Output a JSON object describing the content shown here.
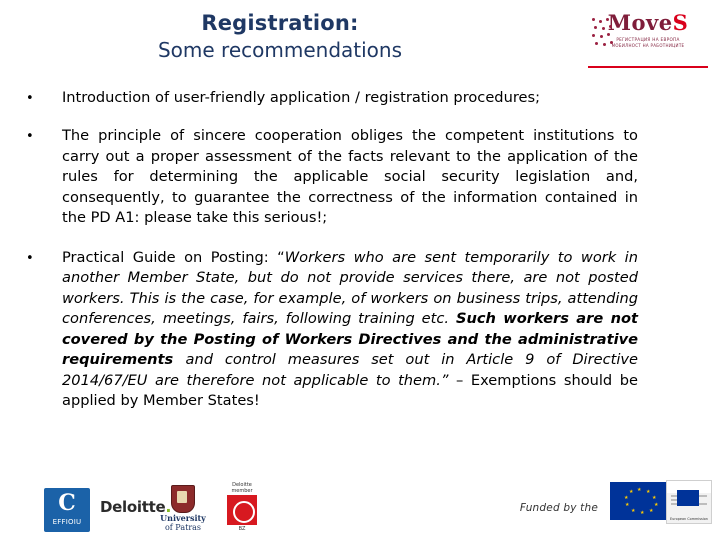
{
  "slide": {
    "title_line1": "Registration:",
    "title_line2": "Some recommendations",
    "bullet_marker": "•"
  },
  "logo": {
    "brand_main": "Move",
    "brand_accent": "S",
    "subtitle_line1": "РЕГИСТРАЦИЯ НА ЕВРОПА",
    "subtitle_line2": "МОБИЛНОСТ НА РАБОТНИЦИТЕ"
  },
  "bullets": [
    {
      "id": "bullet-1",
      "parts": [
        {
          "text": "Introduction of user-friendly application / registration procedures;",
          "style": "normal"
        }
      ]
    },
    {
      "id": "bullet-2",
      "parts": [
        {
          "text": "The principle of sincere cooperation obliges the competent institutions to carry out a proper assessment of the facts relevant to the application of the rules for determining the applicable social security legislation and, consequently, to guarantee the correctness of the information contained in the PD A1: please take this serious!;",
          "style": "normal"
        }
      ]
    },
    {
      "id": "bullet-3",
      "parts": [
        {
          "text": "Practical Guide on Posting: “",
          "style": "normal"
        },
        {
          "text": "Workers who are sent temporarily to work in another Member State, but do not provide services there, are not posted workers. This is the case, for example, of workers on business trips, attending conferences, meetings, fairs, following training etc. ",
          "style": "italic"
        },
        {
          "text": "Such workers are not covered by the Posting of Workers Directives and the administrative requirements ",
          "style": "italic-bold"
        },
        {
          "text": "and control measures set out in Article 9 of Directive 2014/67/EU are therefore not applicable to them.”",
          "style": "italic"
        },
        {
          "text": " – Exemptions should be applied by Member States!",
          "style": "normal"
        }
      ]
    }
  ],
  "footer": {
    "efrei_mark": "C",
    "efrei_name": "EFFIOIU",
    "deloitte": "Deloitte",
    "deloitte_dot": ".",
    "university_line1": "University",
    "university_line2": "of Patras",
    "red_caption": "Deloitte member",
    "red_label": "BZ",
    "funded_text": "Funded by the",
    "eu_doc_caption": "European Commission"
  }
}
